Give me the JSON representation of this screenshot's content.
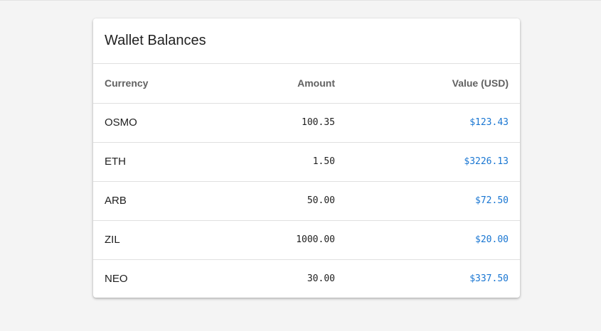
{
  "card": {
    "title": "Wallet Balances"
  },
  "table": {
    "headers": {
      "currency": "Currency",
      "amount": "Amount",
      "value": "Value (USD)"
    },
    "rows": [
      {
        "currency": "OSMO",
        "amount": "100.35",
        "value": "$123.43"
      },
      {
        "currency": "ETH",
        "amount": "1.50",
        "value": "$3226.13"
      },
      {
        "currency": "ARB",
        "amount": "50.00",
        "value": "$72.50"
      },
      {
        "currency": "ZIL",
        "amount": "1000.00",
        "value": "$20.00"
      },
      {
        "currency": "NEO",
        "amount": "30.00",
        "value": "$337.50"
      }
    ]
  },
  "colors": {
    "page_background": "#f4f4f4",
    "card_background": "#ffffff",
    "value_accent": "#1976d2",
    "header_text": "#616161",
    "divider": "#e0e0e0"
  }
}
